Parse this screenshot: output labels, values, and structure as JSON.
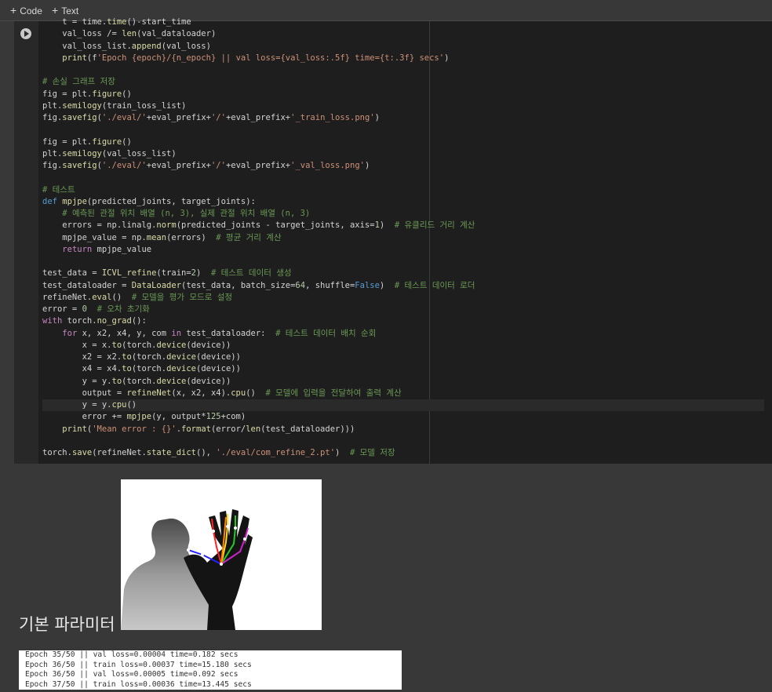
{
  "toolbar": {
    "code_label": "Code",
    "text_label": "Text"
  },
  "code_lines": [
    "    t = time.time()-start_time",
    "    val_loss /= len(val_dataloader)",
    "    val_loss_list.append(val_loss)",
    "    print(f'Epoch {epoch}/{n_epoch} || val loss={val_loss:.5f} time={t:.3f} secs')",
    "",
    "# 손실 그래프 저장",
    "fig = plt.figure()",
    "plt.semilogy(train_loss_list)",
    "fig.savefig('./eval/'+eval_prefix+'/'+eval_prefix+'_train_loss.png')",
    "",
    "fig = plt.figure()",
    "plt.semilogy(val_loss_list)",
    "fig.savefig('./eval/'+eval_prefix+'/'+eval_prefix+'_val_loss.png')",
    "",
    "# 테스트",
    "def mpjpe(predicted_joints, target_joints):",
    "    # 예측된 관절 위치 배열 (n, 3), 실제 관절 위치 배열 (n, 3)",
    "    errors = np.linalg.norm(predicted_joints - target_joints, axis=1)  # 유클리드 거리 계산",
    "    mpjpe_value = np.mean(errors)  # 평균 거리 계산",
    "    return mpjpe_value",
    "",
    "test_data = ICVL_refine(train=2)  # 테스트 데이터 생성",
    "test_dataloader = DataLoader(test_data, batch_size=64, shuffle=False)  # 테스트 데이터 로더",
    "refineNet.eval()  # 모델을 평가 모드로 설정",
    "error = 0  # 오차 초기화",
    "with torch.no_grad():",
    "    for x, x2, x4, y, com in test_dataloader:  # 테스트 데이터 배치 순회",
    "        x = x.to(torch.device(device))",
    "        x2 = x2.to(torch.device(device))",
    "        x4 = x4.to(torch.device(device))",
    "        y = y.to(torch.device(device))",
    "        output = refineNet(x, x2, x4).cpu()  # 모델에 입력을 전달하여 출력 계산",
    "        y = y.cpu()",
    "        error += mpjpe(y, output*125+com)",
    "    print('Mean error : {}'.format(error/len(test_dataloader)))",
    "",
    "torch.save(refineNet.state_dict(), './eval/com_refine_2.pt')  # 모델 저장"
  ],
  "heading": "기본 파라미터",
  "log_lines": [
    "Epoch 35/50 || val loss=0.00004 time=0.182 secs",
    "Epoch 36/50 || train loss=0.00037 time=15.180 secs",
    "Epoch 36/50 || val loss=0.00005 time=0.092 secs",
    "Epoch 37/50 || train loss=0.00036 time=13.445 secs"
  ],
  "colors": {
    "background": "#383838",
    "editor": "#1e1e1e",
    "keyword": "#569cd6",
    "function": "#dcdcaa",
    "string": "#ce9178",
    "comment": "#6a9955",
    "number": "#b5cea8"
  }
}
